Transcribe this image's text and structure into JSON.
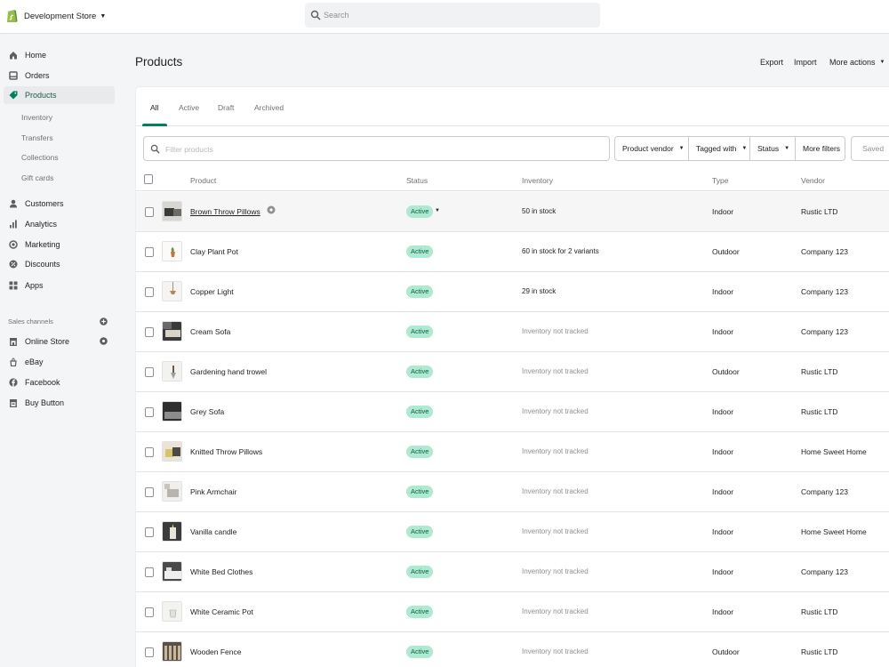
{
  "header": {
    "store_name": "Development Store",
    "search_placeholder": "Search"
  },
  "sidebar": {
    "main_items": [
      {
        "label": "Home",
        "icon": "home-icon"
      },
      {
        "label": "Orders",
        "icon": "orders-icon"
      },
      {
        "label": "Products",
        "icon": "products-icon",
        "active": true
      }
    ],
    "product_subitems": [
      "Inventory",
      "Transfers",
      "Collections",
      "Gift cards"
    ],
    "other_items": [
      {
        "label": "Customers",
        "icon": "customers-icon"
      },
      {
        "label": "Analytics",
        "icon": "analytics-icon"
      },
      {
        "label": "Marketing",
        "icon": "marketing-icon"
      },
      {
        "label": "Discounts",
        "icon": "discounts-icon"
      },
      {
        "label": "Apps",
        "icon": "apps-icon"
      }
    ],
    "sales_channels_title": "Sales channels",
    "sales_channels": [
      {
        "label": "Online Store",
        "icon": "online-store-icon"
      },
      {
        "label": "eBay",
        "icon": "ebay-icon"
      },
      {
        "label": "Facebook",
        "icon": "facebook-icon"
      },
      {
        "label": "Buy Button",
        "icon": "buy-button-icon"
      }
    ]
  },
  "page": {
    "title": "Products",
    "export_label": "Export",
    "import_label": "Import",
    "more_actions_label": "More actions"
  },
  "tabs": [
    "All",
    "Active",
    "Draft",
    "Archived"
  ],
  "filters": {
    "placeholder": "Filter products",
    "vendor": "Product vendor",
    "tagged": "Tagged with",
    "status": "Status",
    "more": "More filters",
    "saved": "Saved"
  },
  "table": {
    "headers": {
      "product": "Product",
      "status": "Status",
      "inventory": "Inventory",
      "type": "Type",
      "vendor": "Vendor"
    },
    "rows": [
      {
        "product": "Brown Throw Pillows",
        "status": "Active",
        "inventory": "50 in stock",
        "type": "Indoor",
        "vendor": "Rustic LTD"
      },
      {
        "product": "Clay Plant Pot",
        "status": "Active",
        "inventory": "60 in stock for 2 variants",
        "type": "Outdoor",
        "vendor": "Company 123"
      },
      {
        "product": "Copper Light",
        "status": "Active",
        "inventory": "29 in stock",
        "type": "Indoor",
        "vendor": "Company 123"
      },
      {
        "product": "Cream Sofa",
        "status": "Active",
        "inventory": "Inventory not tracked",
        "type": "Indoor",
        "vendor": "Company 123"
      },
      {
        "product": "Gardening hand trowel",
        "status": "Active",
        "inventory": "Inventory not tracked",
        "type": "Outdoor",
        "vendor": "Rustic LTD"
      },
      {
        "product": "Grey Sofa",
        "status": "Active",
        "inventory": "Inventory not tracked",
        "type": "Indoor",
        "vendor": "Rustic LTD"
      },
      {
        "product": "Knitted Throw Pillows",
        "status": "Active",
        "inventory": "Inventory not tracked",
        "type": "Indoor",
        "vendor": "Home Sweet Home"
      },
      {
        "product": "Pink Armchair",
        "status": "Active",
        "inventory": "Inventory not tracked",
        "type": "Indoor",
        "vendor": "Company 123"
      },
      {
        "product": "Vanilla candle",
        "status": "Active",
        "inventory": "Inventory not tracked",
        "type": "Indoor",
        "vendor": "Home Sweet Home"
      },
      {
        "product": "White Bed Clothes",
        "status": "Active",
        "inventory": "Inventory not tracked",
        "type": "Indoor",
        "vendor": "Company 123"
      },
      {
        "product": "White Ceramic Pot",
        "status": "Active",
        "inventory": "Inventory not tracked",
        "type": "Indoor",
        "vendor": "Rustic LTD"
      },
      {
        "product": "Wooden Fence",
        "status": "Active",
        "inventory": "Inventory not tracked",
        "type": "Outdoor",
        "vendor": "Rustic LTD"
      }
    ]
  },
  "colors": {
    "brand": "#008060",
    "badge_bg": "#aee9d1",
    "badge_text": "#0d5c42"
  }
}
